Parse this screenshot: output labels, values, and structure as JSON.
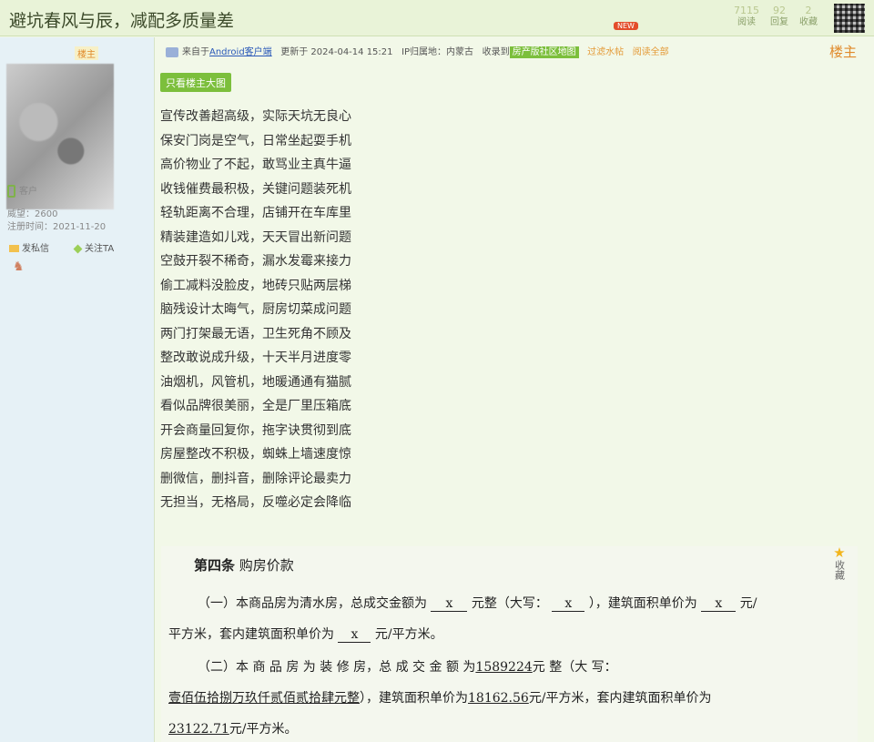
{
  "header": {
    "title": "避坑春风与辰，减配多质量差",
    "stats": [
      {
        "value": "7115",
        "label": "阅读"
      },
      {
        "value": "92",
        "label": "回复"
      },
      {
        "value": "2",
        "label": "收藏"
      }
    ]
  },
  "user": {
    "badge": "楼主",
    "client_label": "客户",
    "points": "威望：2600",
    "register": "注册时间：2021-11-20",
    "message_label": "发私信",
    "follow_label": "关注TA"
  },
  "post_meta": {
    "source_prefix": "来自于",
    "source_app": "Android客户端",
    "updated": "更新于 2024-04-14 15:21",
    "ip": "IP归属地：内蒙古",
    "included": "收录到",
    "tag": "房产版社区地图",
    "new_badge": "NEW",
    "filter_water": "过滤水帖",
    "read_all": "阅读全部",
    "floor": "楼主"
  },
  "only_owner_button": "只看楼主大图",
  "poem": [
    "宣传改善超高级，实际天坑无良心",
    "保安门岗是空气，日常坐起耍手机",
    "高价物业了不起，敢骂业主真牛逼",
    "收钱催费最积极，关键问题装死机",
    "轻轨距离不合理，店铺开在车库里",
    "精装建造如儿戏，天天冒出新问题",
    "空鼓开裂不稀奇，漏水发霉来接力",
    "偷工减料没脸皮，地砖只贴两层梯",
    "脑残设计太晦气，厨房切菜成问题",
    "两门打架最无语，卫生死角不顾及",
    "整改敢说成升级，十天半月进度零",
    "油烟机，风管机，地暖通通有猫腻",
    "看似品牌很美丽，全是厂里压箱底",
    "开会商量回复你，拖字诀贯彻到底",
    "房屋整改不积极，蜘蛛上墙速度惊",
    "删微信，删抖音，删除评论最卖力",
    "无担当，无格局，反噬必定会降临"
  ],
  "doc": {
    "article": "第四条",
    "article_name": "购房价款",
    "p1_a": "（一）本商品房为清水房，总成交金额为",
    "blank_x": "x",
    "p1_b": "元整（大写：",
    "p1_c": "），建筑面积单价为",
    "p1_d": "元/",
    "p1_e": "平方米，套内建筑面积单价为",
    "p1_f": "元/平方米。",
    "p2_a": "（二）本 商 品 房 为 装 修 房，总 成 交 金 额 为",
    "total": "1589224",
    "p2_b": "元 整（大 写：",
    "total_cn": "壹佰伍拾捌万玖仟贰佰贰拾肆元整",
    "p2_c": "），建筑面积单价为",
    "unit_price": "18162.56",
    "p2_d": "元/平方米，套内建筑面积单价为",
    "inner_price": "23122.71",
    "p2_e": "元/平方米。"
  },
  "favorite_label": "收藏"
}
